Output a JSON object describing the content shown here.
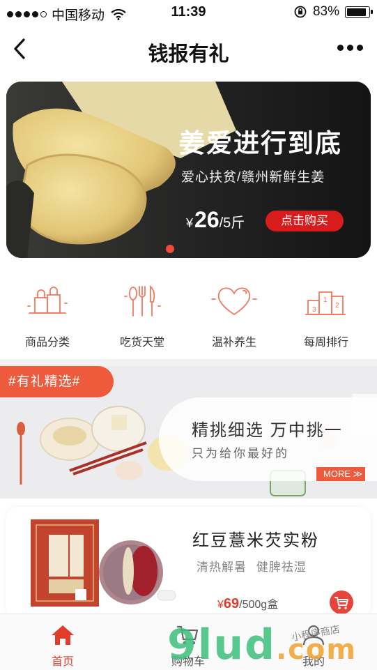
{
  "status_bar": {
    "carrier": "中国移动",
    "time": "11:39",
    "battery": "83%"
  },
  "nav": {
    "title": "钱报有礼"
  },
  "banner": {
    "headline": "姜爱进行到底",
    "subtitle": "爱心扶贫/赣州新鲜生姜",
    "currency": "¥",
    "price": "26",
    "unit": "/5斤",
    "buy_label": "点击购买"
  },
  "categories": [
    {
      "label": "商品分类",
      "icon": "shopping-bags-icon"
    },
    {
      "label": "吃货天堂",
      "icon": "utensils-icon"
    },
    {
      "label": "温补养生",
      "icon": "heart-icon"
    },
    {
      "label": "每周排行",
      "icon": "podium-icon"
    }
  ],
  "feature": {
    "tag": "#有礼精选#",
    "headline": "精挑细选  万中挑一",
    "subtitle": "只为给你最好的",
    "more": "MORE ≫"
  },
  "product": {
    "name": "红豆薏米芡实粉",
    "desc": "清热解暑  健脾祛湿",
    "currency": "¥",
    "price": "69",
    "unit": "/500g盒"
  },
  "tabbar": [
    {
      "label": "首页",
      "icon": "home-icon",
      "active": true
    },
    {
      "label": "购物车",
      "icon": "cart-icon",
      "active": false
    },
    {
      "label": "我的",
      "icon": "user-icon",
      "active": false
    }
  ],
  "watermark": {
    "text": "9lud",
    "suffix": ".com",
    "small": "小程序商店"
  },
  "colors": {
    "accent": "#e23d2c",
    "feature_tag": "#ee5b3c",
    "icon_line": "#f07a5e"
  }
}
